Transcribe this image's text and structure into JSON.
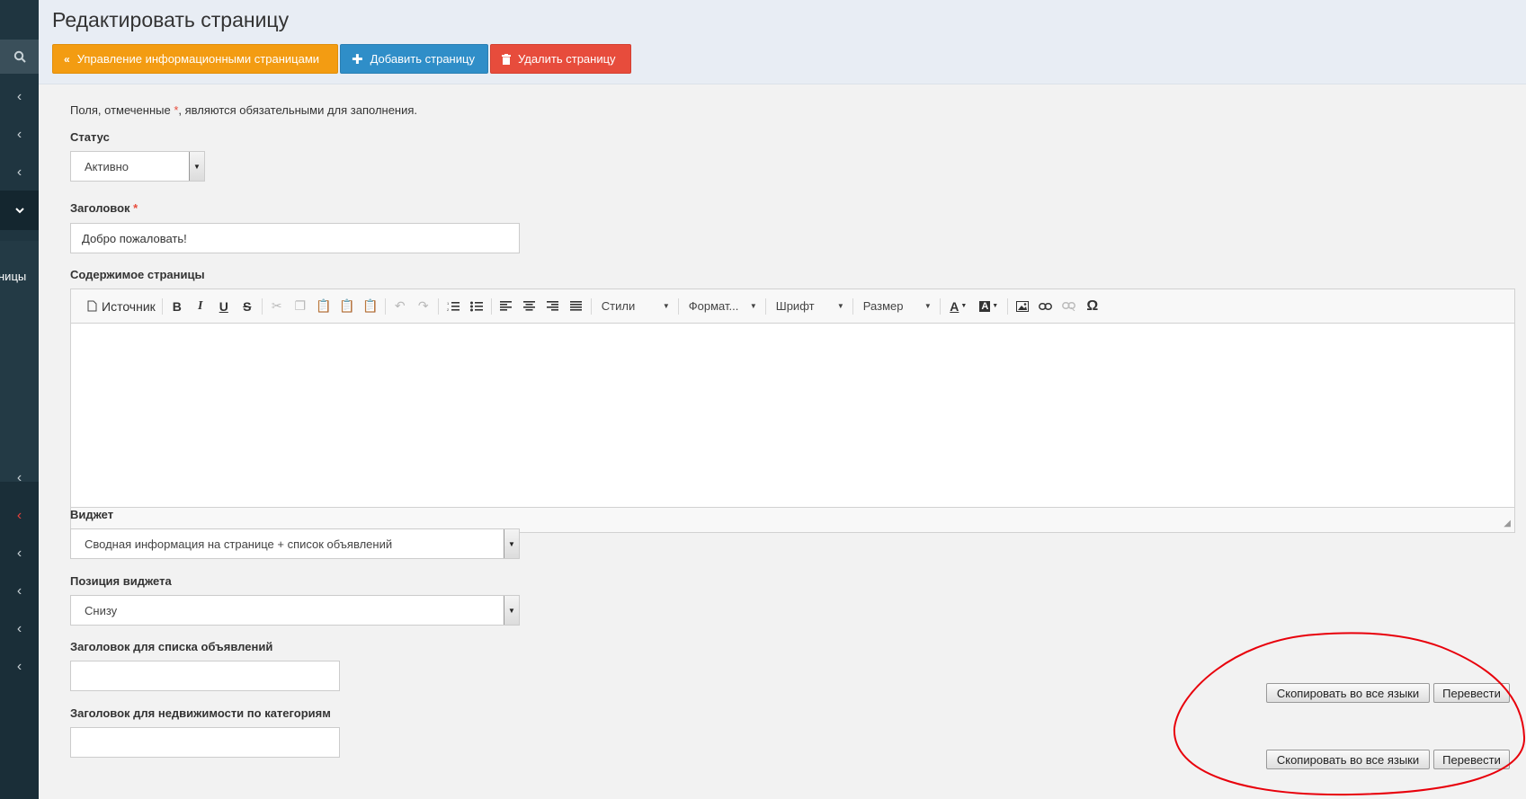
{
  "sidebar": {
    "partial_label": "ницы",
    "icons": [
      "search-icon",
      "chevron-left-icon",
      "chevron-down-icon"
    ]
  },
  "header": {
    "title": "Редактировать страницу",
    "buttons": {
      "manage": "Управление информационными страницами",
      "add": "Добавить страницу",
      "delete": "Удалить страницу"
    }
  },
  "form": {
    "required_note_prefix": "Поля, отмеченные ",
    "required_mark": "*",
    "required_note_suffix": ", являются обязательными для заполнения.",
    "status": {
      "label": "Статус",
      "value": "Активно"
    },
    "title": {
      "label": "Заголовок",
      "value": "Добро пожаловать!"
    },
    "content": {
      "label": "Содержимое страницы"
    },
    "widget": {
      "label": "Виджет",
      "value": "Сводная информация на странице + список объявлений"
    },
    "widget_position": {
      "label": "Позиция виджета",
      "value": "Снизу"
    },
    "ads_list_title": {
      "label": "Заголовок для списка объявлений",
      "value": ""
    },
    "realty_title": {
      "label": "Заголовок для недвижимости по категориям",
      "value": ""
    },
    "copy_all_label": "Скопировать во все языки",
    "translate_label": "Перевести"
  },
  "editor": {
    "source_label": "Источник",
    "styles_label": "Стили",
    "format_label": "Формат...",
    "font_label": "Шрифт",
    "size_label": "Размер"
  },
  "colors": {
    "sidebar": "#1f3540",
    "orange": "#f39c12",
    "blue": "#2f8ec8",
    "red": "#e74c3c",
    "annotation": "#e8000b"
  }
}
